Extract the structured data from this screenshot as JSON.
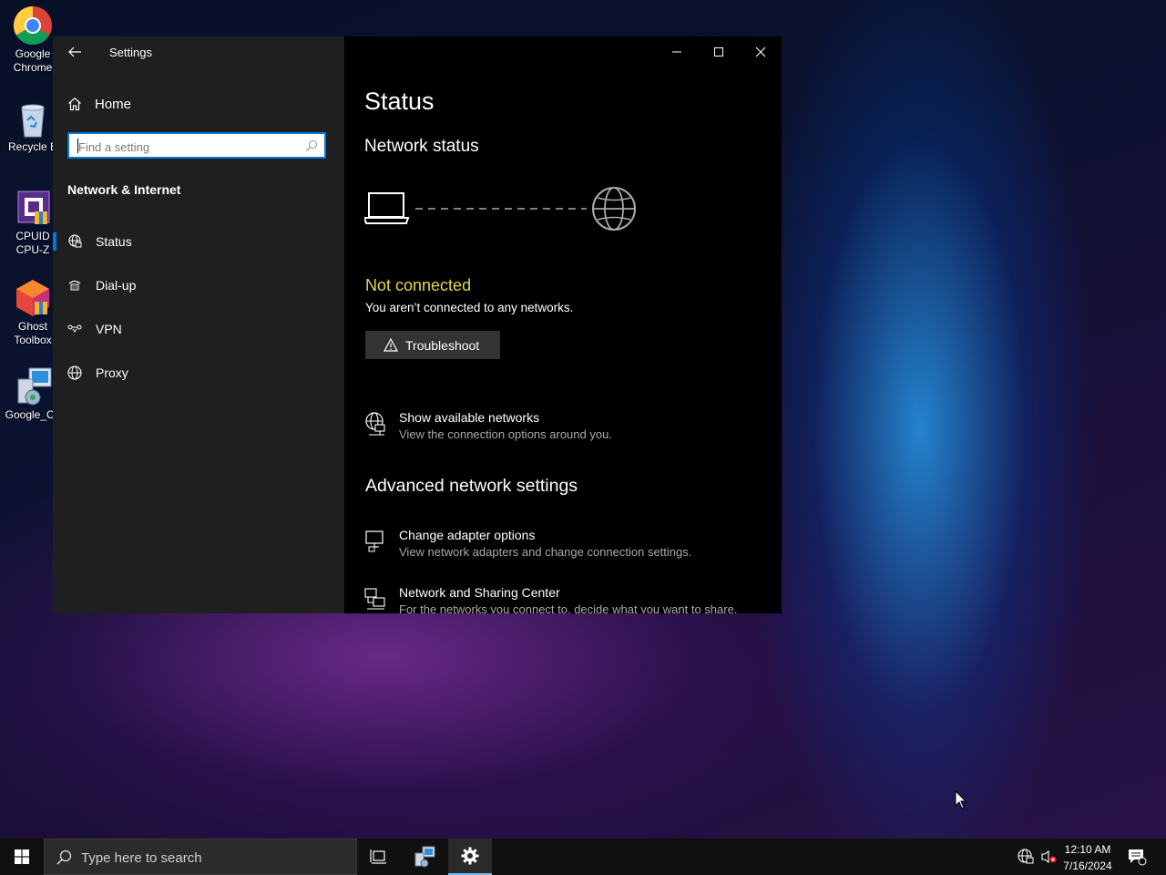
{
  "desktop": {
    "icons": [
      {
        "label_line1": "Google",
        "label_line2": "Chrome",
        "icon": "chrome-icon"
      },
      {
        "label_line1": "Recycle B",
        "label_line2": "",
        "icon": "recycle-bin-icon"
      },
      {
        "label_line1": "CPUID",
        "label_line2": "CPU-Z",
        "icon": "cpuz-icon"
      },
      {
        "label_line1": "Ghost",
        "label_line2": "Toolbox",
        "icon": "ghost-toolbox-icon"
      },
      {
        "label_line1": "Google_Ch",
        "label_line2": "",
        "icon": "installer-icon"
      }
    ]
  },
  "window": {
    "title": "Settings",
    "controls": {
      "minimize": "minimize-icon",
      "maximize": "maximize-icon",
      "close": "close-icon"
    }
  },
  "sidebar": {
    "home_label": "Home",
    "search_placeholder": "Find a setting",
    "section_title": "Network & Internet",
    "items": [
      {
        "label": "Status",
        "icon": "status-globe-icon",
        "active": true
      },
      {
        "label": "Dial-up",
        "icon": "dialup-icon",
        "active": false
      },
      {
        "label": "VPN",
        "icon": "vpn-icon",
        "active": false
      },
      {
        "label": "Proxy",
        "icon": "proxy-globe-icon",
        "active": false
      }
    ]
  },
  "main": {
    "title": "Status",
    "network_status_heading": "Network status",
    "connection_state": "Not connected",
    "connection_detail": "You aren’t connected to any networks.",
    "troubleshoot_label": "Troubleshoot",
    "show_networks": {
      "title": "Show available networks",
      "desc": "View the connection options around you."
    },
    "advanced_heading": "Advanced network settings",
    "adapter_options": {
      "title": "Change adapter options",
      "desc": "View network adapters and change connection settings."
    },
    "sharing_center": {
      "title": "Network and Sharing Center",
      "desc": "For the networks you connect to, decide what you want to share."
    }
  },
  "taskbar": {
    "search_placeholder": "Type here to search",
    "time": "12:10 AM",
    "date": "7/16/2024"
  },
  "colors": {
    "accent": "#0078d7",
    "warning_text": "#e8d44d"
  }
}
